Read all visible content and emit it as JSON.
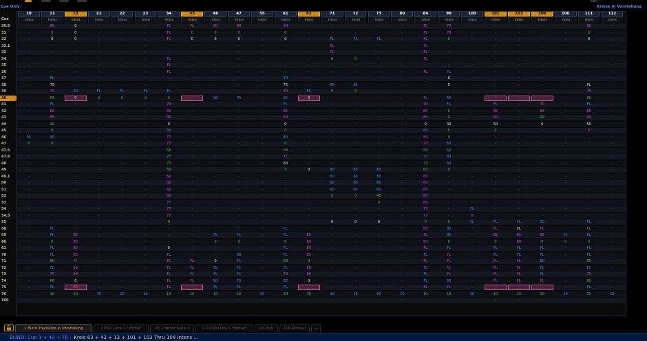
{
  "header": {
    "cue_only": "Cue Only",
    "mode_right": "Kreise in Vorstellung"
  },
  "column_header": "Cue",
  "param_label": "Intens",
  "channels": [
    "10",
    "11",
    "13",
    "21",
    "22",
    "23",
    "34",
    "43",
    "46",
    "47",
    "55",
    "61",
    "63",
    "71",
    "72",
    "73",
    "80",
    "84",
    "98",
    "100",
    "101",
    "103",
    "104",
    "106",
    "111",
    "112"
  ],
  "selected_channels": [
    "13",
    "43",
    "63",
    "101",
    "103",
    "104"
  ],
  "cues": [
    "30.5",
    "31",
    "32",
    "32.1",
    "33",
    "34",
    "35",
    "36",
    "37",
    "38",
    "39",
    "40",
    "41",
    "42",
    "43",
    "44",
    "45",
    "46",
    "47",
    "47.5",
    "47.6",
    "48",
    "49",
    "49.1",
    "50",
    "51",
    "52",
    "53",
    "54",
    "54.5",
    "55",
    "58",
    "59",
    "60",
    "61",
    "70",
    "71",
    "72",
    "73",
    "74",
    "75",
    "76",
    "100"
  ],
  "current_cue": "40",
  "cells": {
    "30.5": {
      "11": "80m",
      "13": "0",
      "34": "FLm",
      "43": "FLm",
      "46": "90m",
      "47": "80m",
      "61": "90m",
      "84": "FLm",
      "98": "70m",
      "111": "90m"
    },
    "31": {
      "11": "0g",
      "13": "0w",
      "34": "FLm",
      "43": "0g",
      "46": "0g",
      "47": "0g",
      "61": "0g",
      "84": "FLm",
      "98": "70m",
      "111": "0g"
    },
    "32": {
      "11": "0w",
      "13": "0w",
      "34": "FLm",
      "43": "0w",
      "46": "0w",
      "47": "0w",
      "61": "0w",
      "71": "FLb",
      "72": "FLb",
      "73": "FLb",
      "84": "FLm",
      "98": "0g",
      "111": "0w"
    },
    "32.1": {
      "71": "FLm",
      "84": "FLm"
    },
    "33": {
      "71": "FLm",
      "84": "FLm"
    },
    "34": {
      "34": "FLm",
      "71": "0g",
      "72": "0g",
      "84": "FLm"
    },
    "35": {
      "34": "FLm"
    },
    "36": {
      "34": "FLm",
      "84": "FLm",
      "98": "FLb"
    },
    "37": {
      "11": "FLb",
      "61": "70b",
      "98": "0w"
    },
    "38": {
      "11": "75w",
      "61": "75w",
      "71": "85b",
      "72": "85b",
      "98": "0w",
      "111": "FLw"
    },
    "39": {
      "11": "70m",
      "13": "60b",
      "21": "FLb",
      "22": "FLb",
      "23": "FLb",
      "34": "FLb",
      "61": "70m",
      "63": "85b",
      "71": "0g",
      "72": "0g",
      "111": "75m"
    },
    "40": {
      "11": "66g",
      "13": "0w",
      "21": "0g",
      "22": "0g",
      "23": "0g",
      "34": "0g",
      "43": "-",
      "46": "90b",
      "47": "70b",
      "61": "82b",
      "63": "0w",
      "84": "FLb",
      "98": "60b",
      "101": "-",
      "103": "-",
      "104": "-",
      "111": "80g"
    },
    "41": {
      "11": "FLb",
      "34": "70m",
      "61": "FLb",
      "84": "70m",
      "98": "FLb",
      "101": "FLb",
      "104": "70m",
      "111": "FLb"
    },
    "42": {
      "11": "85m",
      "34": "85m",
      "61": "85m",
      "84": "85m",
      "98": "0g",
      "101": "85m",
      "104": "85m",
      "111": "85m"
    },
    "43": {
      "11": "85m",
      "34": "80m",
      "61": "80m",
      "84": "80m",
      "98": "0g",
      "101": "80m",
      "104": "69g",
      "111": "80m"
    },
    "44": {
      "11": "40g",
      "34": "0w",
      "61": "0w",
      "84": "0w",
      "98": "40w",
      "101": "50w",
      "104": "0w",
      "111": "50w"
    },
    "45": {
      "11": "0g",
      "34": "60b",
      "61": "0g",
      "84": "60b",
      "98": "0g",
      "101": "0g",
      "111": "0m"
    },
    "46": {
      "10": "65b",
      "11": "40b",
      "34": "77m",
      "61": "40b",
      "84": "80m",
      "98": "0g"
    },
    "47": {
      "10": "0g",
      "11": "0g",
      "34": "77m",
      "61": "0g",
      "84": "77m",
      "98": "60b"
    },
    "47.5": {
      "34": "56g",
      "61": "38g",
      "84": "56g",
      "98": "52g"
    },
    "47.6": {
      "34": "77b",
      "61": "77m",
      "84": "77b",
      "98": "60b"
    },
    "48": {
      "34": "73g",
      "61": "60w",
      "84": "73g",
      "98": "60b"
    },
    "49": {
      "34": "60g",
      "61": "0g",
      "63": "0w",
      "71": "50b",
      "72": "60b",
      "73": "60b",
      "84": "60g",
      "98": "0g"
    },
    "49.1": {
      "34": "60m",
      "71": "60b",
      "72": "60b",
      "73": "60b",
      "84": "60m"
    },
    "50": {
      "34": "60m",
      "71": "60b",
      "72": "60b",
      "73": "60b",
      "84": "60m"
    },
    "51": {
      "34": "60m",
      "71": "60b",
      "72": "60b",
      "73": "60b",
      "84": "60m"
    },
    "52": {
      "34": "60m",
      "71": "0g",
      "72": "0g",
      "73": "40g",
      "84": "60m"
    },
    "53": {
      "34": "77b",
      "73": "0g",
      "84": "60m"
    },
    "54": {
      "34": "77m",
      "84": "77m",
      "100": "FLb"
    },
    "54.5": {
      "34": "77m",
      "84": "77m",
      "100": "0g"
    },
    "55": {
      "34": "0g",
      "71": "0w",
      "72": "0w",
      "73": "0w",
      "84": "0g",
      "98": "0g",
      "100": "FLb",
      "101": "FLb",
      "103": "FLb",
      "104": "50b",
      "111": "FLb"
    },
    "58": {
      "11": "FLb",
      "61": "FLb",
      "84": "85m",
      "98": "85b",
      "101": "FLm",
      "103": "FLw",
      "104": "FLm",
      "111": "FLm"
    },
    "59": {
      "11": "FLb",
      "13": "85m",
      "46": "FLb",
      "47": "FLb",
      "61": "FLb",
      "63": "85m",
      "84": "FLm",
      "98": "85b",
      "101": "85m",
      "103": "85m",
      "104": "85m",
      "106": "FLb",
      "111": "FLb"
    },
    "60": {
      "11": "0g",
      "13": "80m",
      "46": "0g",
      "47": "0g",
      "61": "0g",
      "63": "80m",
      "84": "80m",
      "98": "0g",
      "101": "0g",
      "103": "80m",
      "104": "0g",
      "106": "0g",
      "111": "0g"
    },
    "61": {
      "11": "FLb",
      "13": "85m",
      "34": "0w",
      "61": "FLb",
      "63": "85m",
      "84": "FLm",
      "98": "FLb",
      "101": "FLb",
      "103": "FLb",
      "104": "FLb",
      "111": "FLb"
    },
    "70": {
      "11": "FLb",
      "13": "85m",
      "34": "FLb",
      "47": "80b",
      "61": "FLb",
      "63": "85m",
      "84": "FLb",
      "98": "FLm",
      "101": "FLb",
      "103": "FLb",
      "104": "FLb",
      "111": "FLb"
    },
    "71": {
      "11": "80g",
      "13": "0g",
      "34": "FLm",
      "43": "FLm",
      "46": "0w",
      "47": "FLb",
      "61": "80g",
      "63": "0g",
      "84": "FLm",
      "98": "FLm",
      "101": "FLm",
      "103": "FLm",
      "104": "80b",
      "111": "80g"
    },
    "72": {
      "11": "FLb",
      "13": "85m",
      "34": "FLm",
      "43": "FLm",
      "46": "FLb",
      "47": "FLb",
      "61": "FLb",
      "63": "85m",
      "84": "FLm",
      "98": "FLm",
      "101": "FLm",
      "103": "FLm",
      "104": "FLb",
      "111": "FLb"
    },
    "73": {
      "11": "70m",
      "13": "80m",
      "34": "FLb",
      "43": "FLb",
      "46": "FLb",
      "47": "FLb",
      "61": "70m",
      "63": "80m",
      "84": "FLb",
      "98": "FLm",
      "101": "FLm",
      "103": "FLm",
      "104": "FLb",
      "111": "70m"
    },
    "74": {
      "11": "66g",
      "13": "0w",
      "34": "FLm",
      "43": "FLm",
      "46": "90b",
      "47": "70b",
      "61": "82b",
      "63": "0w",
      "84": "FLb",
      "98": "60b",
      "101": "FLm",
      "103": "FLm",
      "104": "FLm",
      "111": "80g"
    },
    "75": {
      "11": "FLb",
      "13": "80m",
      "34": "FLm",
      "43": "-",
      "46": "FLb",
      "47": "FLb",
      "61": "FLb",
      "63": "-",
      "84": "FLm",
      "98": "FLm",
      "101": "-",
      "103": "-",
      "104": "-",
      "111": "FLb"
    },
    "76": {
      "11": "10g",
      "13": "10g",
      "21": "10b",
      "22": "10b",
      "23": "10b",
      "34": "10g",
      "43": "10g",
      "46": "10g",
      "47": "10g",
      "55": "10b",
      "61": "10g",
      "63": "10g",
      "71": "10b",
      "72": "10b",
      "73": "10b",
      "80": "10b",
      "84": "10g",
      "98": "10g",
      "100": "10b",
      "101": "10g",
      "103": "10g",
      "104": "10g",
      "106": "10b",
      "111": "10g",
      "112": "10b"
    },
    "100": {}
  },
  "highlight": {
    "40": [
      "13",
      "43",
      "63",
      "101",
      "103",
      "104"
    ],
    "75": [
      "13",
      "43",
      "63",
      "101",
      "103",
      "104"
    ]
  },
  "tabs": [
    {
      "label": "1 Blind Trackliste in Vorstellung",
      "active": true
    },
    {
      "label": "2 PSD Liste 1 \"Einfall\"",
      "active": false
    },
    {
      "label": "28.1 Nebel Seite 1",
      "active": false
    },
    {
      "label": "2.2 PSD Liste 1 \"Einfall\"",
      "active": false
    },
    {
      "label": "20 Park",
      "active": false
    },
    {
      "label": "100 Manual",
      "active": false
    },
    {
      "label": "+",
      "active": false
    }
  ],
  "command_line": {
    "prefix": "BLIND: Cue 1 + 40 + 76 :",
    "text": "Kreis 63 + 43 + 13 + 101 + 103 Thru 104 Intens ..."
  },
  "colors": {
    "accent": "#d08a0a",
    "blue": "#3e8cff",
    "green": "#3ec23e",
    "magenta": "#e040e0"
  }
}
